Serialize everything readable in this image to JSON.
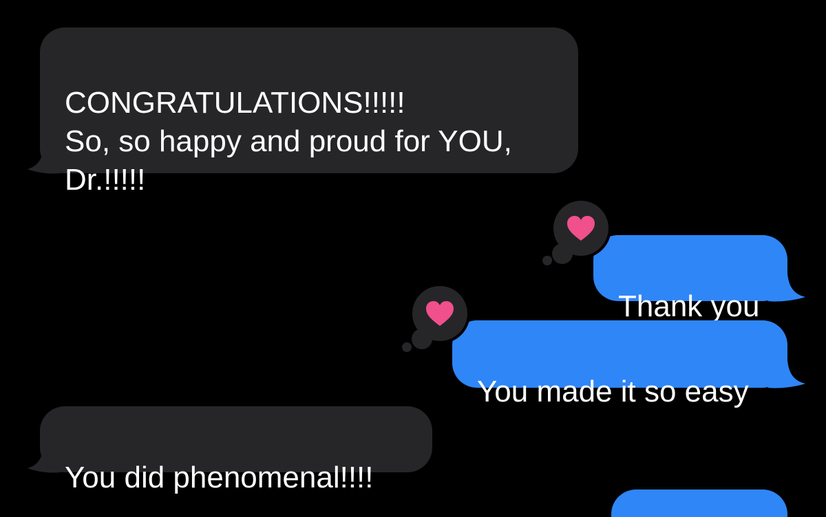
{
  "messages": [
    {
      "direction": "received",
      "text": "CONGRATULATIONS!!!!!\nSo, so happy and proud for YOU,\nDr.!!!!!"
    },
    {
      "direction": "sent",
      "text": "Thank you",
      "reaction": "heart-icon"
    },
    {
      "direction": "sent",
      "text": "You made it so easy",
      "reaction": "heart-icon"
    },
    {
      "direction": "received",
      "text": "You did phenomenal!!!!"
    }
  ],
  "colors": {
    "background": "#000000",
    "received_bubble": "#262628",
    "sent_bubble": "#2f86f6",
    "heart": "#f0508c",
    "text": "#ffffff"
  }
}
